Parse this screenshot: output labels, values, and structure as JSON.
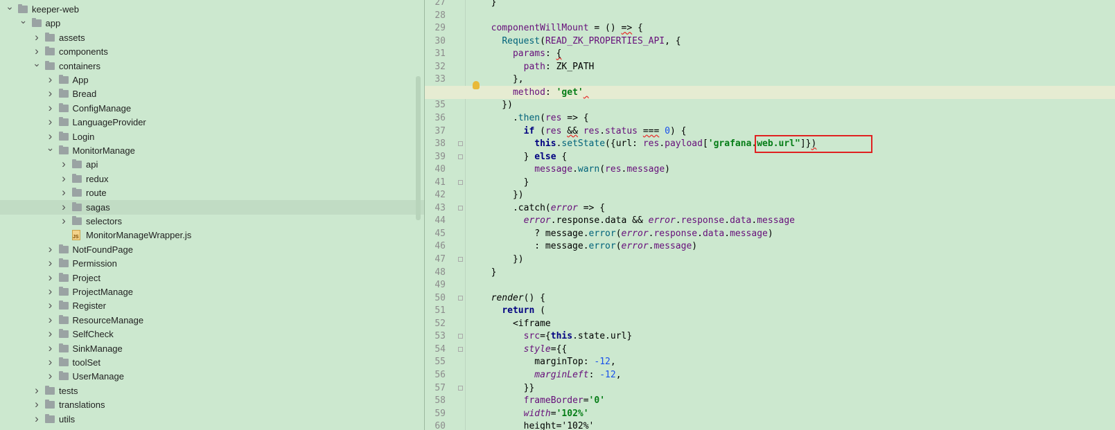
{
  "project_tree": {
    "rows": [
      {
        "label": "keeper-web",
        "depth": 0,
        "expanded": true,
        "icon": "folder-icon"
      },
      {
        "label": "app",
        "depth": 1,
        "expanded": true,
        "icon": "folder-icon"
      },
      {
        "label": "assets",
        "depth": 2,
        "expanded": false,
        "icon": "folder-icon"
      },
      {
        "label": "components",
        "depth": 2,
        "expanded": false,
        "icon": "folder-icon"
      },
      {
        "label": "containers",
        "depth": 2,
        "expanded": true,
        "icon": "folder-icon"
      },
      {
        "label": "App",
        "depth": 3,
        "expanded": false,
        "icon": "folder-icon"
      },
      {
        "label": "Bread",
        "depth": 3,
        "expanded": false,
        "icon": "folder-icon"
      },
      {
        "label": "ConfigManage",
        "depth": 3,
        "expanded": false,
        "icon": "folder-icon"
      },
      {
        "label": "LanguageProvider",
        "depth": 3,
        "expanded": false,
        "icon": "folder-icon"
      },
      {
        "label": "Login",
        "depth": 3,
        "expanded": false,
        "icon": "folder-icon"
      },
      {
        "label": "MonitorManage",
        "depth": 3,
        "expanded": true,
        "icon": "folder-icon"
      },
      {
        "label": "api",
        "depth": 4,
        "expanded": false,
        "icon": "folder-icon"
      },
      {
        "label": "redux",
        "depth": 4,
        "expanded": false,
        "icon": "folder-icon"
      },
      {
        "label": "route",
        "depth": 4,
        "expanded": false,
        "icon": "folder-icon"
      },
      {
        "label": "sagas",
        "depth": 4,
        "expanded": false,
        "icon": "folder-icon",
        "selected": true
      },
      {
        "label": "selectors",
        "depth": 4,
        "expanded": false,
        "icon": "folder-icon"
      },
      {
        "label": "MonitorManageWrapper.js",
        "depth": 4,
        "file": true,
        "icon": "js-file-icon"
      },
      {
        "label": "NotFoundPage",
        "depth": 3,
        "expanded": false,
        "icon": "folder-icon"
      },
      {
        "label": "Permission",
        "depth": 3,
        "expanded": false,
        "icon": "folder-icon"
      },
      {
        "label": "Project",
        "depth": 3,
        "expanded": false,
        "icon": "folder-icon"
      },
      {
        "label": "ProjectManage",
        "depth": 3,
        "expanded": false,
        "icon": "folder-icon"
      },
      {
        "label": "Register",
        "depth": 3,
        "expanded": false,
        "icon": "folder-icon"
      },
      {
        "label": "ResourceManage",
        "depth": 3,
        "expanded": false,
        "icon": "folder-icon"
      },
      {
        "label": "SelfCheck",
        "depth": 3,
        "expanded": false,
        "icon": "folder-icon"
      },
      {
        "label": "SinkManage",
        "depth": 3,
        "expanded": false,
        "icon": "folder-icon"
      },
      {
        "label": "toolSet",
        "depth": 3,
        "expanded": false,
        "icon": "folder-icon"
      },
      {
        "label": "UserManage",
        "depth": 3,
        "expanded": false,
        "icon": "folder-icon"
      },
      {
        "label": "tests",
        "depth": 2,
        "expanded": false,
        "icon": "folder-icon"
      },
      {
        "label": "translations",
        "depth": 2,
        "expanded": false,
        "icon": "folder-icon"
      },
      {
        "label": "utils",
        "depth": 2,
        "expanded": false,
        "icon": "folder-icon"
      }
    ]
  },
  "editor": {
    "first_line_number": 27,
    "highlighted_line": 34,
    "boxed_text": "grafana.web.url\"",
    "lines": [
      {
        "n": 27,
        "html": "  }"
      },
      {
        "n": 28,
        "html": ""
      },
      {
        "n": 29,
        "html": "  <span class='prop'>componentWillMount</span> = () <span class='wavy'>=></span> {"
      },
      {
        "n": 30,
        "html": "    <span class='fn'>Request</span>(<span class='prop'>READ_ZK_PROPERTIES_API</span>, {"
      },
      {
        "n": 31,
        "html": "      <span class='prop'>params</span>: <span class='wavy'>{</span>"
      },
      {
        "n": 32,
        "html": "        <span class='prop'>path</span>: ZK_PATH"
      },
      {
        "n": 33,
        "html": "      },"
      },
      {
        "n": 34,
        "html": "      <span class='prop'>method</span>: <span class='str'>'get'</span><span class='wavy'> </span>"
      },
      {
        "n": 35,
        "html": "    })"
      },
      {
        "n": 36,
        "html": "      .<span class='fn'>then</span>(<span class='prop'>res</span> => {"
      },
      {
        "n": 37,
        "html": "        <span class='kw'>if</span> (<span class='prop'>res</span> <span class='wavy'>&&</span> <span class='prop'>res</span>.<span class='prop'>status</span> <span class='wavy'>===</span> <span class='num'>0</span>) {"
      },
      {
        "n": 38,
        "html": "          <span class='kw'>this</span>.<span class='fn'>setState</span>({url: <span class='prop'>res</span>.<span class='prop'>payload</span>[<span class='str'>'grafana.web.url\"</span>]}<span class='wavy'>)</span>"
      },
      {
        "n": 39,
        "html": "        } <span class='kw'>else</span> {"
      },
      {
        "n": 40,
        "html": "          <span class='prop'>message</span>.<span class='fn'>warn</span>(<span class='prop'>res</span>.<span class='prop'>message</span>)"
      },
      {
        "n": 41,
        "html": "        }"
      },
      {
        "n": 42,
        "html": "      })"
      },
      {
        "n": 43,
        "html": "      .catch(<span class='prop it'>error</span> => {"
      },
      {
        "n": 44,
        "html": "        <span class='prop it'>error</span>.response.data && <span class='prop it'>error</span>.<span class='prop'>response</span>.<span class='prop'>data</span>.<span class='prop'>message</span>"
      },
      {
        "n": 45,
        "html": "          ? message.<span class='fn'>error</span>(<span class='prop it'>error</span>.<span class='prop'>response</span>.<span class='prop'>data</span>.<span class='prop'>message</span>)"
      },
      {
        "n": 46,
        "html": "          : message.<span class='fn'>error</span>(<span class='prop it'>error</span>.<span class='prop'>message</span>)"
      },
      {
        "n": 47,
        "html": "      })"
      },
      {
        "n": 48,
        "html": "  }"
      },
      {
        "n": 49,
        "html": ""
      },
      {
        "n": 50,
        "html": "  <span class='it'>render</span>() {"
      },
      {
        "n": 51,
        "html": "    <span class='kw'>return</span> ("
      },
      {
        "n": 52,
        "html": "      &lt;iframe"
      },
      {
        "n": 53,
        "html": "        <span class='prop'>src</span>={<span class='kw'>this</span>.state.url}"
      },
      {
        "n": 54,
        "html": "        <span class='prop it'>style</span>={{"
      },
      {
        "n": 55,
        "html": "          marginTop: <span class='num'>-12</span>,"
      },
      {
        "n": 56,
        "html": "          <span class='prop it'>marginLeft</span>: <span class='num'>-12</span>,"
      },
      {
        "n": 57,
        "html": "        }}"
      },
      {
        "n": 58,
        "html": "        <span class='prop'>frameBorder</span>=<span class='str'>'0'</span>"
      },
      {
        "n": 59,
        "html": "        <span class='prop it'>width</span>=<span class='str'>'102%'</span>"
      },
      {
        "n": 60,
        "html": "        height='102%'"
      }
    ]
  }
}
